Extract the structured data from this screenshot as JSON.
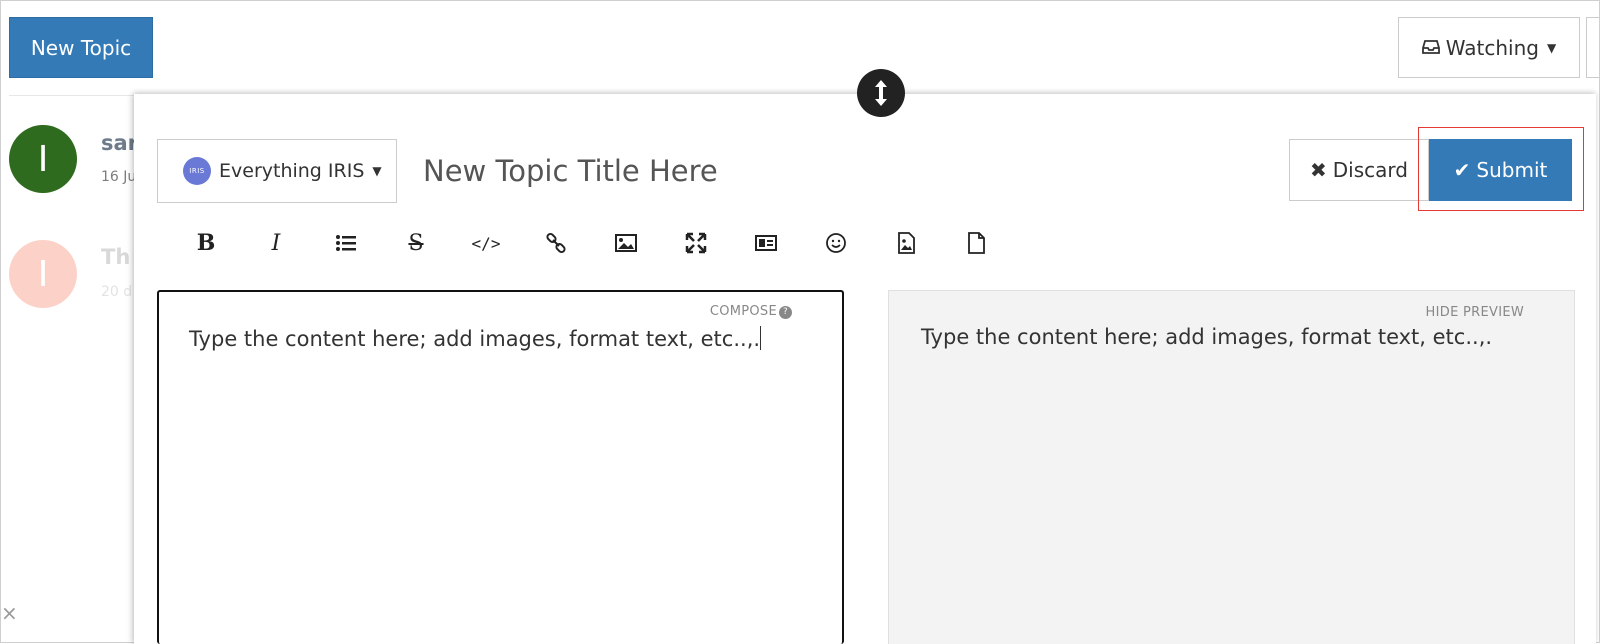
{
  "header": {
    "new_topic_label": "New Topic",
    "watching_label": "Watching"
  },
  "topics": [
    {
      "avatar_letter": "I",
      "avatar_color": "#2e6b1e",
      "author_partial": "sar",
      "date_partial": "16 Ju"
    },
    {
      "avatar_letter": "I",
      "avatar_color": "#fcd2c8",
      "author_partial": "Th",
      "date_partial": "20 d"
    }
  ],
  "composer": {
    "category_label": "Everything IRIS",
    "category_logo_text": "IRIS",
    "title_placeholder": "New Topic Title Here",
    "discard_label": "Discard",
    "submit_label": "Submit",
    "toolbar": [
      "bold-icon",
      "italic-icon",
      "list-icon",
      "strikethrough-icon",
      "code-icon",
      "link-icon",
      "image-icon",
      "fullscreen-icon",
      "card-icon",
      "emoji-icon",
      "image-file-icon",
      "file-icon"
    ],
    "compose_label": "COMPOSE",
    "editor_text": "Type the content here; add images, format text, etc..,.",
    "hide_preview_label": "HIDE PREVIEW",
    "preview_text": "Type the content here; add images, format text, etc..,."
  },
  "colors": {
    "primary": "#337ab7",
    "highlight": "#e53935"
  }
}
